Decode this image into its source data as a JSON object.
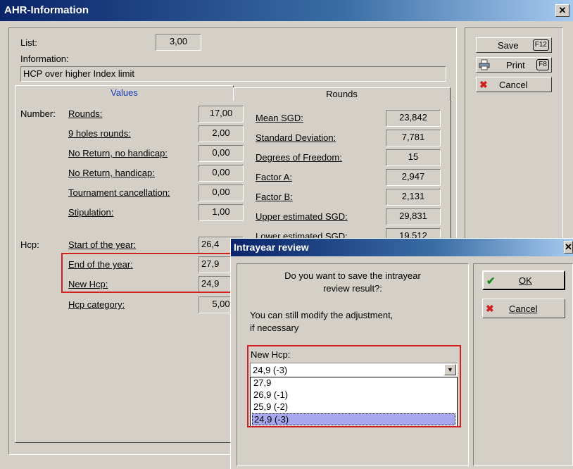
{
  "main_window": {
    "title": "AHR-Information",
    "list_label": "List:",
    "list_value": "3,00",
    "information_label": "Information:",
    "information_value": "HCP over higher Index limit",
    "tabs": [
      {
        "label": "Values"
      },
      {
        "label": "Rounds"
      }
    ],
    "number_label": "Number:",
    "numbers": [
      {
        "label": "Rounds:",
        "value": "17,00"
      },
      {
        "label": "9 holes rounds:",
        "value": "2,00"
      },
      {
        "label": "No Return, no handicap:",
        "value": "0,00"
      },
      {
        "label": "No Return, handicap:",
        "value": "0,00"
      },
      {
        "label": "Tournament cancellation:",
        "value": "0,00"
      },
      {
        "label": "Stipulation:",
        "value": "1,00"
      }
    ],
    "stats": [
      {
        "label": "Mean SGD:",
        "value": "23,842"
      },
      {
        "label": "Standard Deviation:",
        "value": "7,781"
      },
      {
        "label": "Degrees of Freedom:",
        "value": "15"
      },
      {
        "label": "Factor A:",
        "value": "2,947"
      },
      {
        "label": "Factor B:",
        "value": "2,131"
      },
      {
        "label": "Upper estimated SGD:",
        "value": "29,831"
      },
      {
        "label": "Lower estimated SGD:",
        "value": "19,512"
      }
    ],
    "hcp_label": "Hcp:",
    "hcp": [
      {
        "label": "Start of the year:",
        "value": "26,4"
      },
      {
        "label": "End of the year:",
        "value": "27,9"
      },
      {
        "label": "New Hcp:",
        "value": "24,9"
      },
      {
        "label": "Hcp category:",
        "value": "5,00"
      }
    ],
    "buttons": {
      "save": {
        "label": "Save",
        "key": "F12"
      },
      "print": {
        "label": "Print",
        "key": "F8"
      },
      "cancel": {
        "label": "Cancel"
      }
    }
  },
  "dialog": {
    "title": "Intrayear review",
    "question_line1": "Do you want to save the intrayear",
    "question_line2": "review result?:",
    "note_line1": "You can still modify the adjustment,",
    "note_line2": "if necessary",
    "new_hcp_label": "New Hcp:",
    "selected_value": "24,9 (-3)",
    "options": [
      "27,9",
      "26,9 (-1)",
      "25,9 (-2)",
      "24,9 (-3)"
    ],
    "ok_label": "OK",
    "cancel_label": "Cancel"
  },
  "colors": {
    "title_start": "#0a246a",
    "title_end": "#a6caf0",
    "highlight_red": "#d32020",
    "selection": "#a7a7ef"
  }
}
